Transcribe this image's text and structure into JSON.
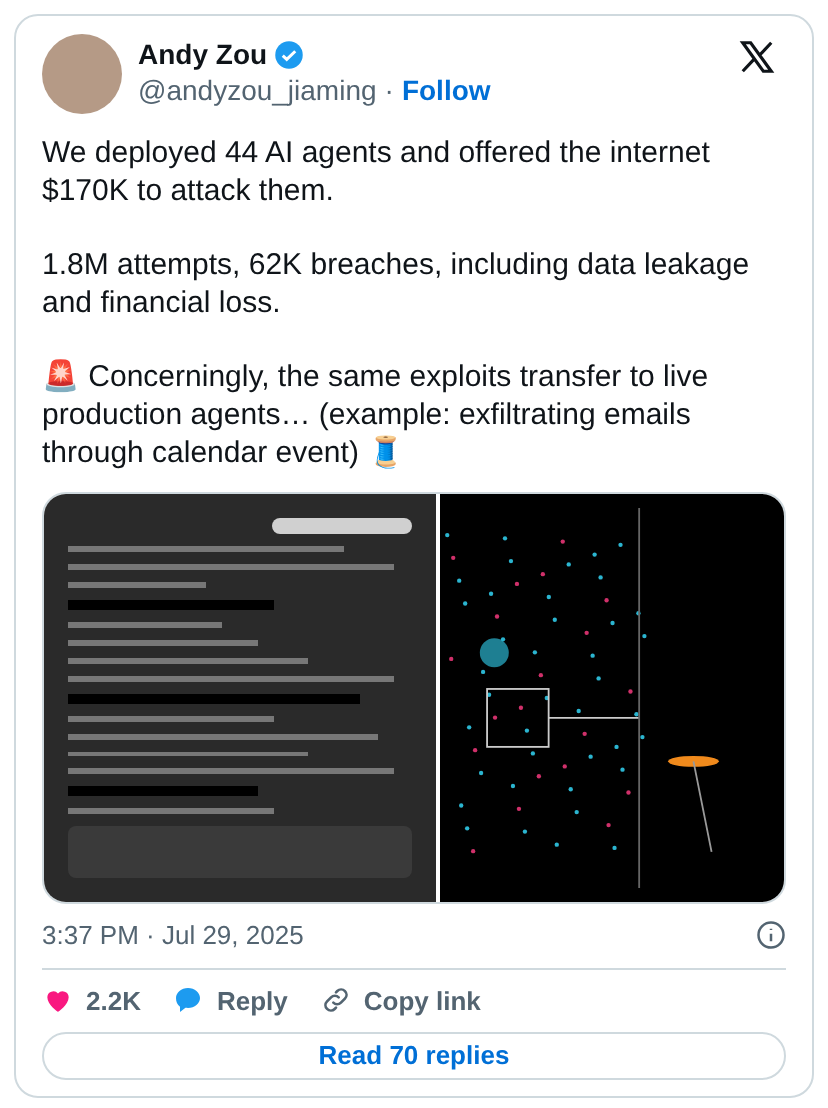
{
  "author": {
    "name": "Andy Zou",
    "verified": true,
    "handle": "@andyzou_jiaming",
    "separator": "·",
    "follow": "Follow"
  },
  "paragraphs": [
    "We deployed 44 AI agents and offered the internet $170K to attack them.",
    "1.8M attempts, 62K breaches, including data leakage and financial loss.",
    "🚨 Concerningly, the same exploits transfer to live production agents… (example: exfiltrating emails through calendar event) 🧵"
  ],
  "media": [
    {
      "kind": "chat"
    },
    {
      "kind": "scatter"
    }
  ],
  "timestamp": "3:37 PM · Jul 29, 2025",
  "actions": [
    {
      "kind": "like",
      "label": "2.2K"
    },
    {
      "kind": "reply",
      "label": "Reply"
    },
    {
      "kind": "copy",
      "label": "Copy link"
    }
  ],
  "read_replies": "Read 70 replies"
}
